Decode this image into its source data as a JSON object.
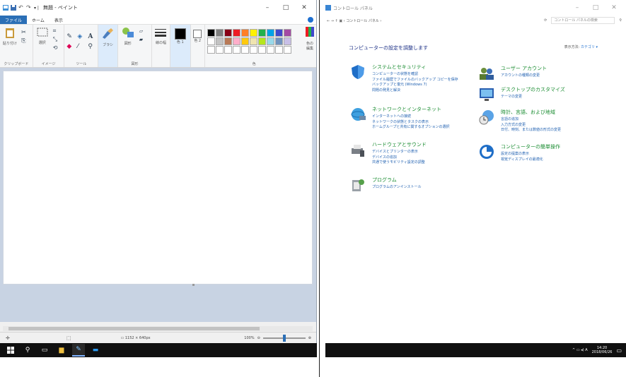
{
  "paint": {
    "title": "無題 - ペイント",
    "window_controls": [
      "–",
      "□",
      "✕"
    ],
    "tabs": [
      {
        "label": "ファイル"
      },
      {
        "label": "ホーム"
      },
      {
        "label": "表示"
      }
    ],
    "ribbon": {
      "clipboard_label": "クリップボード",
      "paste_label": "貼り付け",
      "image_label": "イメージ",
      "select_label": "選択",
      "tools_label": "ツール",
      "brush_label": "ブラシ",
      "shapes_label": "図形",
      "shape_label": "図形",
      "outline_label": "線の幅",
      "color1_label": "色 1",
      "color2_label": "色 2",
      "colors_label": "色",
      "edit_colors_label": "色の編集"
    },
    "palette": [
      "#000000",
      "#7f7f7f",
      "#880015",
      "#ed1c24",
      "#ff7f27",
      "#fff200",
      "#22b14c",
      "#00a2e8",
      "#3f48cc",
      "#a349a4",
      "#ffffff",
      "#c3c3c3",
      "#b97a57",
      "#ffaec9",
      "#ffc90e",
      "#efe4b0",
      "#b5e61d",
      "#99d9ea",
      "#7092be",
      "#c8bfe7",
      "#ffffff",
      "#ffffff",
      "#ffffff",
      "#ffffff",
      "#ffffff",
      "#ffffff",
      "#ffffff",
      "#ffffff",
      "#ffffff",
      "#ffffff"
    ],
    "status": {
      "dimensions": "1152 × 640px",
      "zoom": "100%"
    }
  },
  "taskbar_left": {
    "icons": [
      "windows-icon",
      "search-icon",
      "task-view-icon",
      "explorer-icon",
      "paint-icon",
      "mail-icon"
    ]
  },
  "control_panel": {
    "title": "コントロール パネル",
    "window_controls": [
      "–",
      "□",
      "✕"
    ],
    "address_path": "← → ↑  ▣ › コントロール パネル ›",
    "search_placeholder": "コントロール パネルの検索",
    "heading": "コンピューターの設定を調整します",
    "view_by_label": "表示方法:",
    "view_by_value": "カテゴリ ▾",
    "categories_left": [
      {
        "title": "システムとセキュリティ",
        "links": [
          "コンピューターの状態を確認",
          "ファイル履歴でファイルのバックアップ コピーを保存",
          "バックアップと復元 (Windows 7)",
          "問題の発見と解決"
        ]
      },
      {
        "title": "ネットワークとインターネット",
        "links": [
          "インターネットへの接続",
          "ネットワークの状態とタスクの表示",
          "ホームグループと共有に関するオプションの選択"
        ]
      },
      {
        "title": "ハードウェアとサウンド",
        "links": [
          "デバイスとプリンターの表示",
          "デバイスの追加",
          "共通で使うモビリティ設定の調整"
        ]
      },
      {
        "title": "プログラム",
        "links": [
          "プログラムのアンインストール"
        ]
      }
    ],
    "categories_right": [
      {
        "title": "ユーザー アカウント",
        "links": [
          "アカウントの種類の変更"
        ]
      },
      {
        "title": "デスクトップのカスタマイズ",
        "links": [
          "テーマの変更"
        ]
      },
      {
        "title": "時計、言語、および地域",
        "links": [
          "言語の追加",
          "入力方式の変更",
          "日付、時刻、または数値の形式の変更"
        ]
      },
      {
        "title": "コンピューターの簡単操作",
        "links": [
          "設定の提案の表示",
          "視覚ディスプレイの最適化"
        ]
      }
    ]
  },
  "taskbar_right": {
    "tray": "^ ▭ ◂) A",
    "time": "14:20",
    "date": "2018/06/26"
  }
}
